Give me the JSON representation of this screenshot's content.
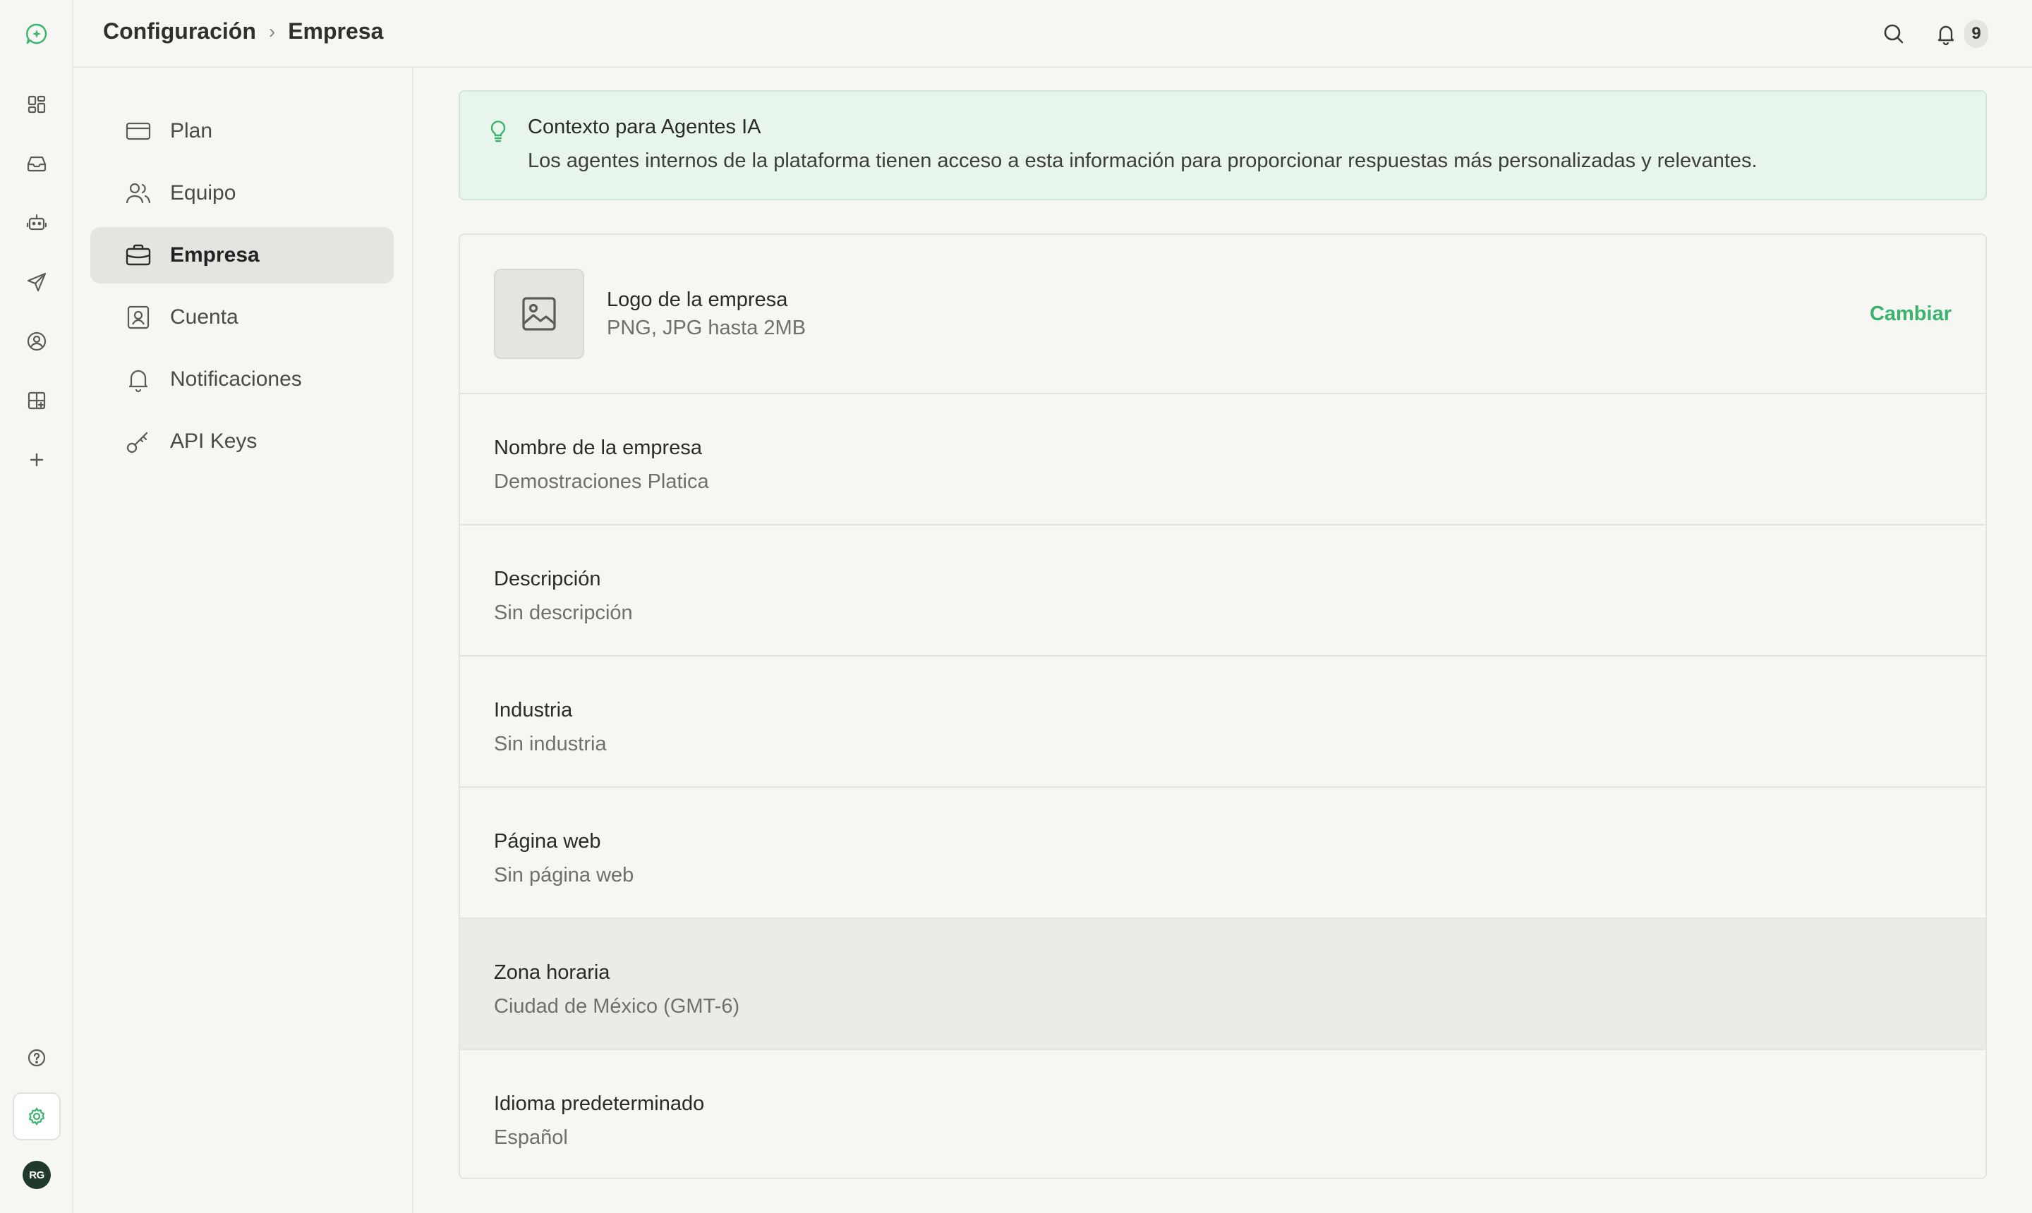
{
  "header": {
    "breadcrumb_parent": "Configuración",
    "breadcrumb_separator": "›",
    "breadcrumb_current": "Empresa",
    "notifications_count": "9"
  },
  "rail": {
    "avatar_initials": "RG",
    "icons": [
      "chat-logo-icon",
      "dashboard-icon",
      "inbox-icon",
      "bot-icon",
      "send-icon",
      "contact-icon",
      "add-widget-icon",
      "plus-icon",
      "help-icon",
      "gear-icon"
    ]
  },
  "settings_nav": {
    "items": [
      {
        "label": "Plan",
        "icon": "credit-card-icon"
      },
      {
        "label": "Equipo",
        "icon": "users-icon"
      },
      {
        "label": "Empresa",
        "icon": "briefcase-icon"
      },
      {
        "label": "Cuenta",
        "icon": "contact-card-icon"
      },
      {
        "label": "Notificaciones",
        "icon": "bell-icon"
      },
      {
        "label": "API Keys",
        "icon": "key-icon"
      }
    ]
  },
  "info": {
    "title": "Contexto para Agentes IA",
    "body": "Los agentes internos de la plataforma tienen acceso a esta información para proporcionar respuestas más personalizadas y relevantes."
  },
  "company": {
    "logo_label": "Logo de la empresa",
    "logo_hint": "PNG, JPG hasta 2MB",
    "change_label": "Cambiar",
    "fields": [
      {
        "label": "Nombre de la empresa",
        "value": "Demostraciones Platica"
      },
      {
        "label": "Descripción",
        "value": "Sin descripción"
      },
      {
        "label": "Industria",
        "value": "Sin industria"
      },
      {
        "label": "Página web",
        "value": "Sin página web"
      },
      {
        "label": "Zona horaria",
        "value": "Ciudad de México (GMT-6)"
      },
      {
        "label": "Idioma predeterminado",
        "value": "Español"
      }
    ]
  },
  "colors": {
    "accent": "#3ab36e",
    "info_bg": "#e8f5ec",
    "selected_bg": "#e4e4e0"
  }
}
